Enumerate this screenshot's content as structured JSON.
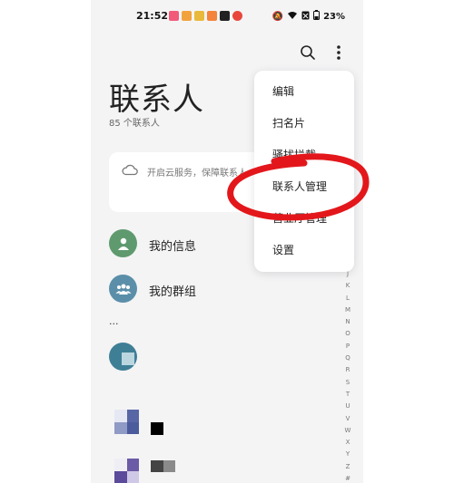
{
  "status_bar": {
    "time": "21:52",
    "battery": "23%",
    "notification_colors": [
      "#f25a7a",
      "#f2a23d",
      "#e8b93a",
      "#f4843c",
      "#222222",
      "#e8463c"
    ]
  },
  "header": {
    "search_icon": "search-icon",
    "more_icon": "more-vertical-icon"
  },
  "page": {
    "title": "联系人",
    "count": "85 个联系人"
  },
  "cloud_banner": {
    "icon": "cloud-icon",
    "text": "开启云服务，保障联系人"
  },
  "list": {
    "my_info": "我的信息",
    "my_groups": "我的群组",
    "ellipsis": "..."
  },
  "index_letters": [
    "J",
    "K",
    "L",
    "M",
    "N",
    "O",
    "P",
    "Q",
    "R",
    "S",
    "T",
    "U",
    "V",
    "W",
    "X",
    "Y",
    "Z",
    "#"
  ],
  "menu": {
    "items": [
      "编辑",
      "扫名片",
      "骚扰拦截",
      "联系人管理",
      "营业厅管理",
      "设置"
    ]
  },
  "colors": {
    "accent_green": "#5f9a6e",
    "accent_blue": "#5b8fa9",
    "annotation_red": "#e3171b"
  }
}
